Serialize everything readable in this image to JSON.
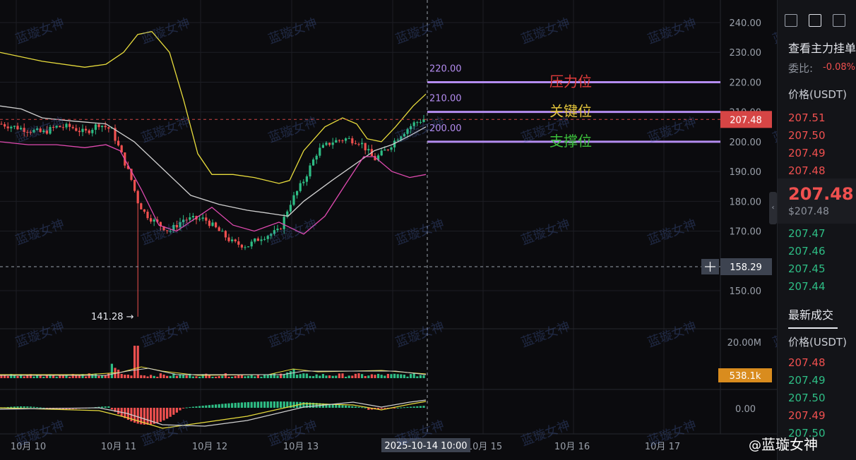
{
  "chart_data": {
    "type": "candlestick",
    "y_ticks": [
      "240.00",
      "230.00",
      "220.00",
      "210.00",
      "200.00",
      "190.00",
      "180.00",
      "170.00",
      "150.00"
    ],
    "y_tick_values": [
      240,
      230,
      220,
      210,
      200,
      190,
      180,
      170,
      150
    ],
    "ylim": [
      138,
      246
    ],
    "x_ticks": [
      "10月 10",
      "10月 11",
      "10月 12",
      "10月 13",
      "10月 15",
      "10月 16",
      "10月 17"
    ],
    "crosshair_time_label": "2025-10-14 10:00",
    "crosshair_price": "158.29",
    "current_price": "207.48",
    "low_marker": "141.28 →",
    "levels": [
      {
        "value": 220,
        "label": "220.00",
        "text": "压力位",
        "text_color": "#e03b3b"
      },
      {
        "value": 210,
        "label": "210.00",
        "text": "关键位",
        "text_color": "#e0c23b"
      },
      {
        "value": 200,
        "label": "200.00",
        "text": "支撑位",
        "text_color": "#3bbf3b"
      }
    ],
    "volume_ticks": [
      "20.00M"
    ],
    "volume_current": "538.1k",
    "macd_ticks": [
      "0.00"
    ],
    "colors": {
      "up": "#2ebd85",
      "down": "#f0504f",
      "bb_upper": "#e8dc3c",
      "bb_mid": "#d0d0d0",
      "bb_lower": "#e04ab0",
      "level_line": "#b48cf0"
    }
  },
  "sidepanel": {
    "title": "查看主力挂单",
    "ratio_label": "委比:",
    "ratio_value": "-0.08%",
    "price_header": "价格(USDT)",
    "asks": [
      "207.51",
      "207.50",
      "207.49",
      "207.48"
    ],
    "last_price": "207.48",
    "last_price_usd": "$207.48",
    "bids": [
      "207.47",
      "207.46",
      "207.45",
      "207.44"
    ],
    "trades_title": "最新成交",
    "trades_header": "价格(USDT)",
    "trades": [
      {
        "price": "207.48",
        "side": "sell"
      },
      {
        "price": "207.49",
        "side": "buy"
      },
      {
        "price": "207.50",
        "side": "buy"
      },
      {
        "price": "207.49",
        "side": "sell"
      },
      {
        "price": "207.50",
        "side": "buy"
      }
    ]
  },
  "watermark": "蓝璇女神",
  "footer": {
    "at": "@",
    "name": "蓝璇女神"
  }
}
